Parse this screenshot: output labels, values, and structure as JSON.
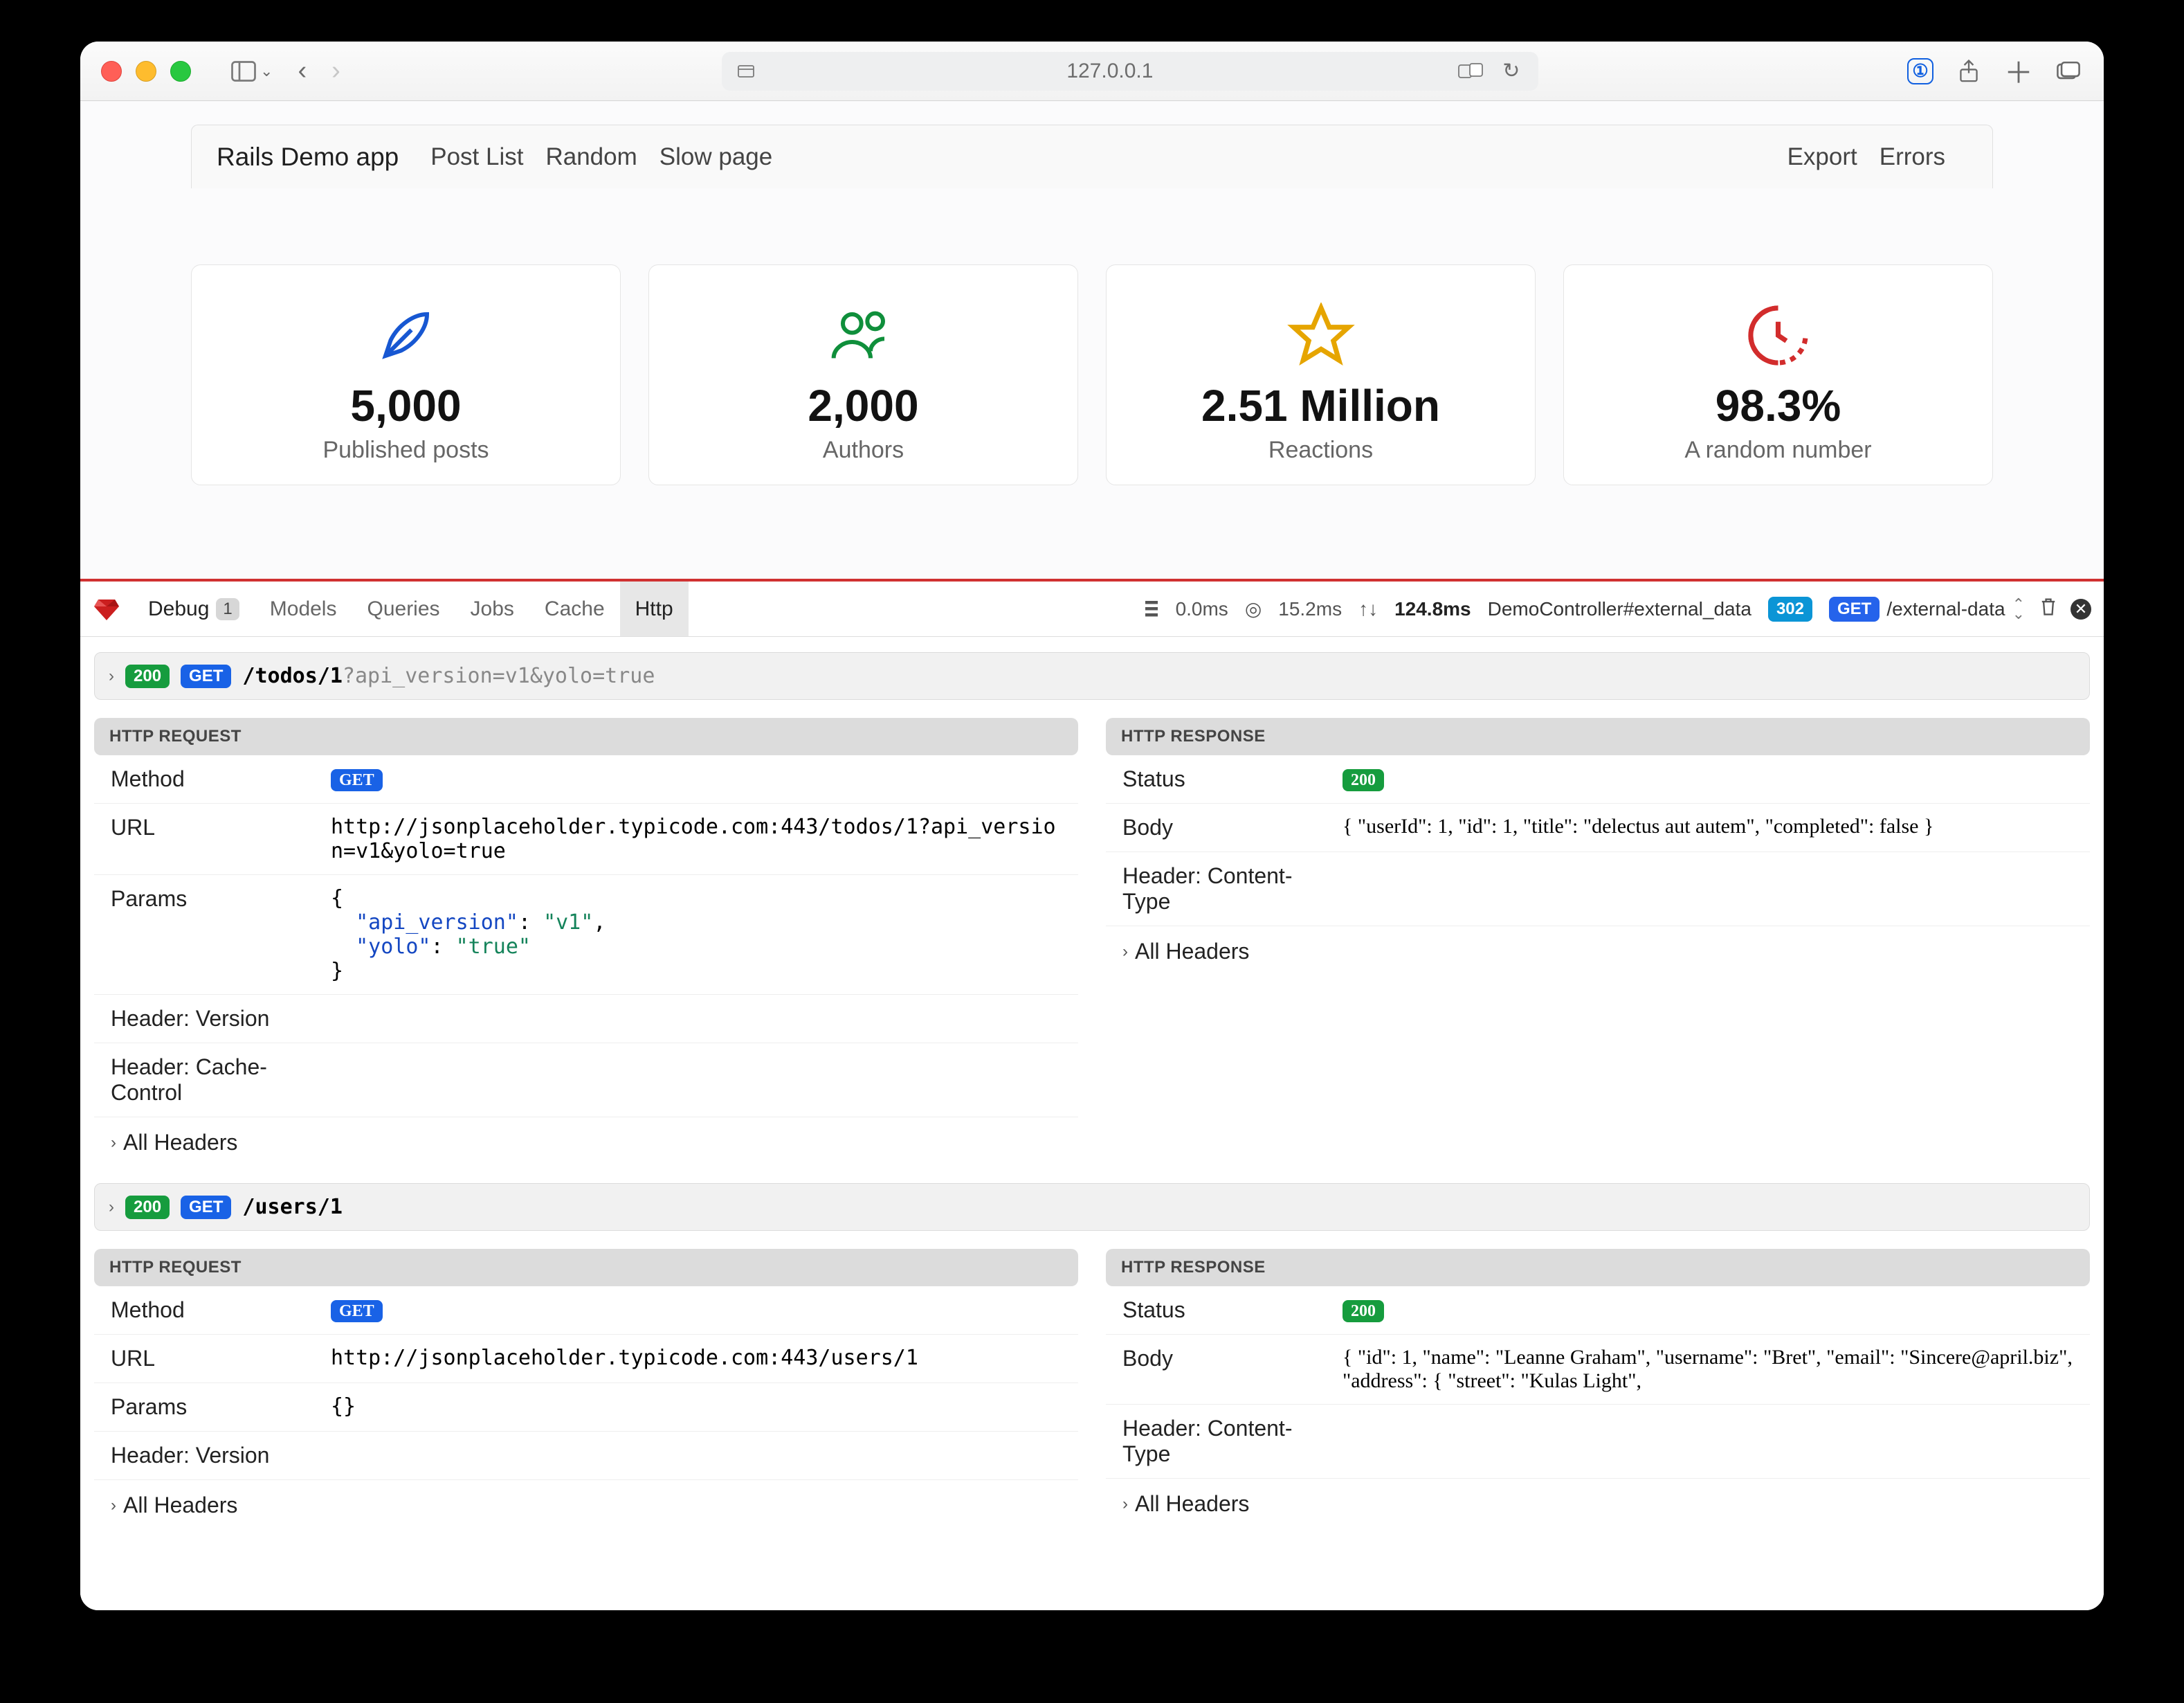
{
  "browser": {
    "url": "127.0.0.1"
  },
  "nav": {
    "brand": "Rails Demo app",
    "links": [
      "Post List",
      "Random",
      "Slow page"
    ],
    "right": [
      "Export",
      "Errors"
    ]
  },
  "cards": [
    {
      "icon": "feather",
      "value": "5,000",
      "label": "Published posts",
      "color": "#1757d2"
    },
    {
      "icon": "users",
      "value": "2,000",
      "label": "Authors",
      "color": "#0f8f3b"
    },
    {
      "icon": "star",
      "value": "2.51 Million",
      "label": "Reactions",
      "color": "#e6a500"
    },
    {
      "icon": "clock",
      "value": "98.3%",
      "label": "A random number",
      "color": "#d22c2c"
    }
  ],
  "debugbar": {
    "tabs": [
      {
        "label": "Debug",
        "count": "1"
      },
      {
        "label": "Models"
      },
      {
        "label": "Queries"
      },
      {
        "label": "Jobs"
      },
      {
        "label": "Cache"
      },
      {
        "label": "Http",
        "active": true
      }
    ],
    "status": {
      "db": "0.0ms",
      "cpu": "15.2ms",
      "total": "124.8ms",
      "controller": "DemoController#external_data",
      "status_code": "302",
      "method": "GET",
      "path": "/external-data"
    }
  },
  "requests": [
    {
      "status": "200",
      "method": "GET",
      "path_main": "/todos/1",
      "path_query": "?api_version=v1&yolo=true",
      "req": {
        "method": "GET",
        "url": "http://jsonplaceholder.typicode.com:443/todos/1?api_version=v1&yolo=true",
        "params": "{\n  \"api_version\": \"v1\",\n  \"yolo\": \"true\"\n}",
        "headers": [
          "Header: Version",
          "Header: Cache-Control"
        ],
        "all_headers": "All Headers"
      },
      "res": {
        "status": "200",
        "body": "{ \"userId\": 1, \"id\": 1, \"title\": \"delectus aut autem\", \"completed\": false }",
        "headers": [
          "Header: Content-Type"
        ],
        "all_headers": "All Headers"
      }
    },
    {
      "status": "200",
      "method": "GET",
      "path_main": "/users/1",
      "path_query": "",
      "req": {
        "method": "GET",
        "url": "http://jsonplaceholder.typicode.com:443/users/1",
        "params": "{}",
        "headers": [
          "Header: Version"
        ],
        "all_headers": "All Headers"
      },
      "res": {
        "status": "200",
        "body": "{ \"id\": 1, \"name\": \"Leanne Graham\", \"username\": \"Bret\", \"email\": \"Sincere@april.biz\", \"address\": { \"street\": \"Kulas Light\",",
        "headers": [
          "Header: Content-Type"
        ],
        "all_headers": "All Headers"
      }
    }
  ],
  "labels": {
    "http_request": "HTTP Request",
    "http_response": "HTTP Response",
    "method": "Method",
    "url": "URL",
    "params": "Params",
    "status": "Status",
    "body": "Body"
  }
}
